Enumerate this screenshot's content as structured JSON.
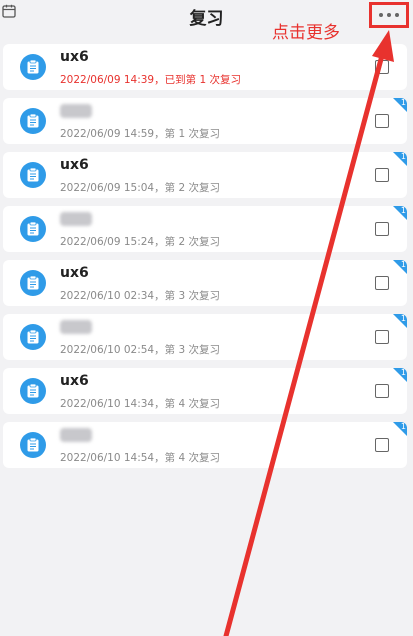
{
  "header": {
    "title": "复习",
    "more_label": "···"
  },
  "annotation": {
    "text": "点击更多",
    "color": "#e8322e"
  },
  "colors": {
    "accent": "#2f9be8",
    "highlight": "#e8322e"
  },
  "items": [
    {
      "title": "ux6",
      "subtitle": "2022/06/09 14:39，已到第 1 次复习",
      "highlight": true,
      "title_hidden": false
    },
    {
      "title": "",
      "subtitle": "2022/06/09 14:59，第 1 次复习",
      "highlight": false,
      "title_hidden": true
    },
    {
      "title": "ux6",
      "subtitle": "2022/06/09 15:04，第 2 次复习",
      "highlight": false,
      "title_hidden": false
    },
    {
      "title": "",
      "subtitle": "2022/06/09 15:24，第 2 次复习",
      "highlight": false,
      "title_hidden": true
    },
    {
      "title": "ux6",
      "subtitle": "2022/06/10 02:34，第 3 次复习",
      "highlight": false,
      "title_hidden": false
    },
    {
      "title": "",
      "subtitle": "2022/06/10 02:54，第 3 次复习",
      "highlight": false,
      "title_hidden": true
    },
    {
      "title": "ux6",
      "subtitle": "2022/06/10 14:34，第 4 次复习",
      "highlight": false,
      "title_hidden": false
    },
    {
      "title": "",
      "subtitle": "2022/06/10 14:54，第 4 次复习",
      "highlight": false,
      "title_hidden": true
    }
  ],
  "badge_text": "1"
}
